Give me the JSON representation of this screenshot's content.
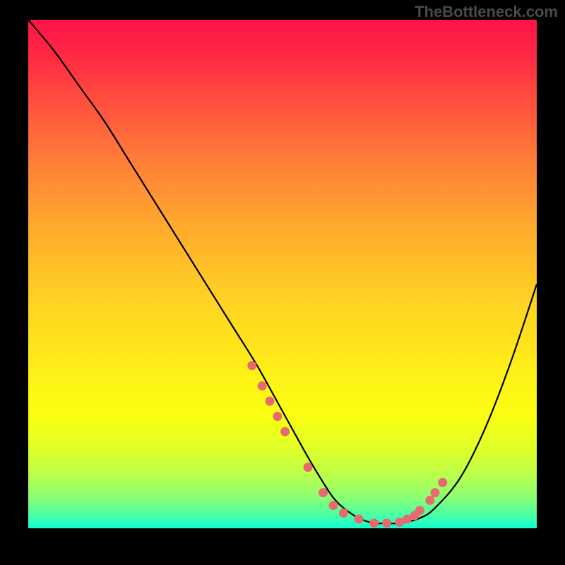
{
  "watermark": "TheBottleneck.com",
  "chart_data": {
    "type": "line",
    "title": "",
    "xlabel": "",
    "ylabel": "",
    "xlim": [
      0,
      100
    ],
    "ylim": [
      0,
      100
    ],
    "curve": {
      "name": "bottleneck-curve",
      "x": [
        0,
        5,
        10,
        15,
        20,
        25,
        30,
        35,
        40,
        45,
        50,
        55,
        58,
        60,
        62,
        65,
        68,
        70,
        73,
        77,
        80,
        85,
        90,
        95,
        100
      ],
      "y": [
        100,
        94,
        87,
        80,
        72,
        64,
        56,
        48,
        40,
        32,
        23,
        14,
        9,
        6,
        4,
        2,
        1,
        1,
        1,
        2,
        4,
        10,
        20,
        33,
        48
      ]
    },
    "marker_points": {
      "name": "highlight-dots",
      "color": "#e86a6e",
      "x": [
        44,
        46,
        47.5,
        49,
        50.5,
        55,
        58,
        60,
        62,
        65,
        68,
        70.5,
        73,
        74.5,
        76,
        77,
        79,
        80,
        81.5
      ],
      "y": [
        32,
        28,
        25,
        22,
        19,
        12,
        7,
        4.5,
        3,
        1.8,
        1,
        1,
        1.2,
        1.8,
        2.5,
        3.5,
        5.5,
        7,
        9
      ]
    }
  }
}
